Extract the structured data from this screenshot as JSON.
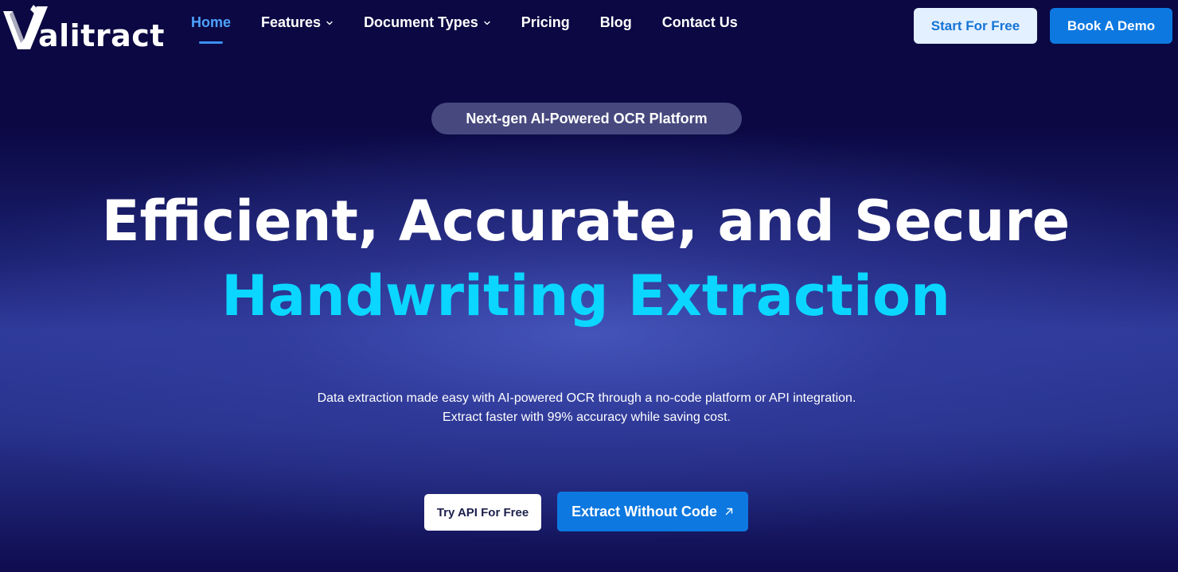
{
  "header": {
    "logo_text": "alitract",
    "nav": [
      {
        "label": "Home",
        "active": true,
        "dropdown": false
      },
      {
        "label": "Features",
        "active": false,
        "dropdown": true
      },
      {
        "label": "Document Types",
        "active": false,
        "dropdown": true
      },
      {
        "label": "Pricing",
        "active": false,
        "dropdown": false
      },
      {
        "label": "Blog",
        "active": false,
        "dropdown": false
      },
      {
        "label": "Contact Us",
        "active": false,
        "dropdown": false
      }
    ],
    "start_button": "Start For Free",
    "demo_button": "Book A Demo"
  },
  "hero": {
    "badge": "Next-gen AI-Powered OCR Platform",
    "headline_line1": "Efficient, Accurate, and Secure",
    "headline_line2": "Handwriting Extraction",
    "subtext_line1": "Data extraction made easy with AI-powered OCR through a no-code platform or API integration.",
    "subtext_line2": "Extract faster with 99% accuracy while saving cost.",
    "api_button": "Try API For Free",
    "nocode_button": "Extract Without Code"
  },
  "icons": {
    "logo": "valitract-v-logo-icon",
    "dropdown": "chevron-down-icon",
    "external": "arrow-up-right-icon"
  },
  "colors": {
    "background": "#0b0843",
    "accent_blue": "#0d78e0",
    "headline_cyan": "#0bd6ff",
    "active_nav": "#4ea2ff"
  }
}
